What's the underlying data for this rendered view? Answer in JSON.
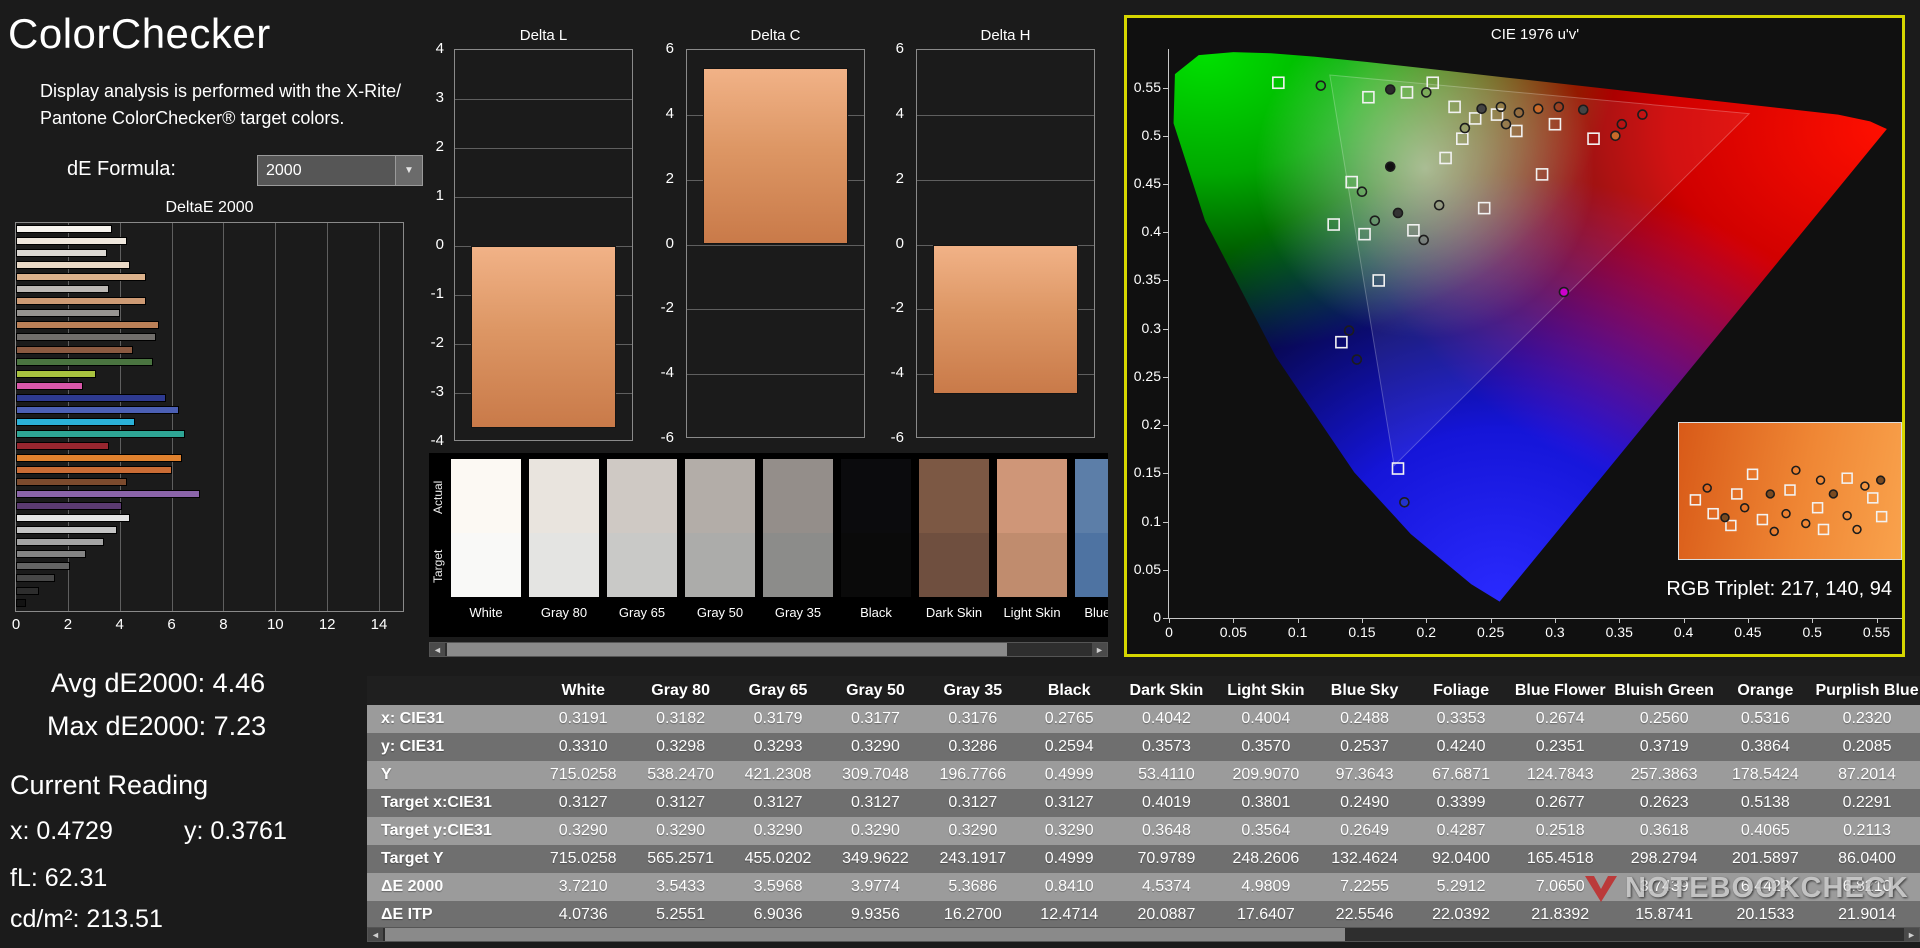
{
  "header": {
    "title": "ColorChecker",
    "description_line1": "Display analysis is performed with the X-Rite/",
    "description_line2": "Pantone ColorChecker® target colors.",
    "de_formula_label": "dE Formula:",
    "de_formula_value": "2000"
  },
  "readings": {
    "avg": "Avg dE2000: 4.46",
    "max": "Max dE2000: 7.23",
    "current_label": "Current Reading",
    "x": "x: 0.4729",
    "y": "y: 0.3761",
    "fl": "fL: 62.31",
    "cd": "cd/m²: 213.51"
  },
  "chart_data": [
    {
      "type": "bar",
      "title": "DeltaE 2000",
      "orientation": "horizontal",
      "xlim": [
        0,
        14
      ],
      "x_ticks": [
        "0",
        "2",
        "4",
        "6",
        "8",
        "10",
        "12",
        "14"
      ],
      "grid": true,
      "bars": [
        {
          "color": "#f7f4ef",
          "value": 3.7
        },
        {
          "color": "#efe7dd",
          "value": 4.3
        },
        {
          "color": "#dcd8d3",
          "value": 3.5
        },
        {
          "color": "#ead9c6",
          "value": 4.4
        },
        {
          "color": "#dcb28c",
          "value": 5.0
        },
        {
          "color": "#bcb8b4",
          "value": 3.6
        },
        {
          "color": "#cd9a74",
          "value": 5.0
        },
        {
          "color": "#969390",
          "value": 4.0
        },
        {
          "color": "#bb8057",
          "value": 5.5
        },
        {
          "color": "#716e6b",
          "value": 5.4
        },
        {
          "color": "#8b5a41",
          "value": 4.5
        },
        {
          "color": "#4a7440",
          "value": 5.3
        },
        {
          "color": "#a8c23f",
          "value": 3.1
        },
        {
          "color": "#d957a9",
          "value": 2.6
        },
        {
          "color": "#2e3a90",
          "value": 5.8
        },
        {
          "color": "#4c60b5",
          "value": 6.3
        },
        {
          "color": "#2bb1d8",
          "value": 4.6
        },
        {
          "color": "#2ea595",
          "value": 6.5
        },
        {
          "color": "#97262f",
          "value": 3.6
        },
        {
          "color": "#e0812e",
          "value": 6.4
        },
        {
          "color": "#ca6c35",
          "value": 6.0
        },
        {
          "color": "#7c4b2e",
          "value": 4.3
        },
        {
          "color": "#8a64a9",
          "value": 7.1
        },
        {
          "color": "#5b3a71",
          "value": 4.1
        },
        {
          "color": "#e4e4e4",
          "value": 4.4
        },
        {
          "color": "#c4c4c4",
          "value": 3.9
        },
        {
          "color": "#a4a4a4",
          "value": 3.4
        },
        {
          "color": "#848484",
          "value": 2.7
        },
        {
          "color": "#646464",
          "value": 2.1
        },
        {
          "color": "#474747",
          "value": 1.5
        },
        {
          "color": "#2d2d2d",
          "value": 0.9
        },
        {
          "color": "#121212",
          "value": 0.4
        }
      ]
    },
    {
      "type": "bar",
      "title": "Delta L",
      "ylim": [
        -4,
        4
      ],
      "y_ticks": [
        "4",
        "3",
        "2",
        "1",
        "0",
        "-1",
        "-2",
        "-3",
        "-4"
      ],
      "value": -3.72,
      "bar_colors": [
        "#f1b287",
        "#dd9765",
        "#c97a49"
      ]
    },
    {
      "type": "bar",
      "title": "Delta C",
      "ylim": [
        -6,
        6
      ],
      "y_ticks": [
        "6",
        "4",
        "2",
        "0",
        "-2",
        "-4",
        "-6"
      ],
      "value": 5.45,
      "bar_colors": [
        "#f1b287",
        "#dd9765",
        "#c97a49"
      ]
    },
    {
      "type": "bar",
      "title": "Delta H",
      "ylim": [
        -6,
        6
      ],
      "y_ticks": [
        "6",
        "4",
        "2",
        "0",
        "-2",
        "-4",
        "-6"
      ],
      "value": -4.62,
      "bar_colors": [
        "#f1b287",
        "#dd9765",
        "#c97a49"
      ]
    },
    {
      "type": "scatter",
      "title": "CIE 1976 u'v'",
      "border_color": "#d6d600",
      "xlim": [
        0,
        0.569
      ],
      "ylim": [
        0,
        0.59
      ],
      "x_ticks": [
        "0",
        "0.05",
        "0.1",
        "0.15",
        "0.2",
        "0.25",
        "0.3",
        "0.35",
        "0.4",
        "0.45",
        "0.5",
        "0.55"
      ],
      "y_ticks": [
        "0",
        "0.05",
        "0.1",
        "0.15",
        "0.2",
        "0.25",
        "0.3",
        "0.35",
        "0.4",
        "0.45",
        "0.5",
        "0.55"
      ],
      "rgb_triplet": "RGB Triplet: 217, 140, 94",
      "gamut_triangle": [
        [
          0.125,
          0.563
        ],
        [
          0.451,
          0.523
        ],
        [
          0.175,
          0.158
        ]
      ],
      "targets": [
        [
          0.085,
          0.555
        ],
        [
          0.155,
          0.54
        ],
        [
          0.185,
          0.545
        ],
        [
          0.205,
          0.555
        ],
        [
          0.222,
          0.53
        ],
        [
          0.238,
          0.518
        ],
        [
          0.255,
          0.522
        ],
        [
          0.27,
          0.505
        ],
        [
          0.3,
          0.512
        ],
        [
          0.33,
          0.497
        ],
        [
          0.228,
          0.497
        ],
        [
          0.215,
          0.477
        ],
        [
          0.142,
          0.452
        ],
        [
          0.128,
          0.408
        ],
        [
          0.152,
          0.398
        ],
        [
          0.19,
          0.402
        ],
        [
          0.163,
          0.35
        ],
        [
          0.134,
          0.286
        ],
        [
          0.178,
          0.155
        ],
        [
          0.245,
          0.425
        ],
        [
          0.29,
          0.46
        ]
      ],
      "measured": [
        [
          0.118,
          0.552,
          "none"
        ],
        [
          0.172,
          0.548,
          "#2a2a2a"
        ],
        [
          0.2,
          0.545,
          "none"
        ],
        [
          0.243,
          0.528,
          "#444444"
        ],
        [
          0.258,
          0.53,
          "none"
        ],
        [
          0.272,
          0.524,
          "none"
        ],
        [
          0.287,
          0.528,
          "#c96a2a"
        ],
        [
          0.303,
          0.53,
          "none"
        ],
        [
          0.322,
          0.527,
          "#444444"
        ],
        [
          0.352,
          0.512,
          "none"
        ],
        [
          0.172,
          0.468,
          "#111111"
        ],
        [
          0.15,
          0.442,
          "none"
        ],
        [
          0.16,
          0.412,
          "none"
        ],
        [
          0.178,
          0.42,
          "#333333"
        ],
        [
          0.198,
          0.392,
          "none"
        ],
        [
          0.14,
          0.298,
          "none"
        ],
        [
          0.146,
          0.268,
          "none"
        ],
        [
          0.307,
          0.338,
          "#cc00cc"
        ],
        [
          0.21,
          0.428,
          "none"
        ],
        [
          0.183,
          0.12,
          "#2233cc"
        ],
        [
          0.347,
          0.5,
          "#c96a2a"
        ],
        [
          0.368,
          0.522,
          "none"
        ],
        [
          0.262,
          0.512,
          "none"
        ],
        [
          0.23,
          0.508,
          "none"
        ]
      ],
      "inset": {
        "gradient": [
          "#d85a18",
          "#ef8634",
          "#f9a24c"
        ],
        "squares": [
          [
            16,
            78
          ],
          [
            34,
            92
          ],
          [
            58,
            72
          ],
          [
            84,
            98
          ],
          [
            112,
            68
          ],
          [
            140,
            86
          ],
          [
            170,
            56
          ],
          [
            196,
            76
          ],
          [
            146,
            108
          ],
          [
            74,
            52
          ],
          [
            205,
            95
          ],
          [
            52,
            104
          ]
        ],
        "circles": [
          [
            28,
            66,
            "none"
          ],
          [
            46,
            96,
            "#7a4a20"
          ],
          [
            66,
            86,
            "none"
          ],
          [
            92,
            72,
            "#7a4a20"
          ],
          [
            108,
            92,
            "none"
          ],
          [
            128,
            102,
            "none"
          ],
          [
            156,
            72,
            "#7a4a20"
          ],
          [
            170,
            94,
            "none"
          ],
          [
            188,
            64,
            "none"
          ],
          [
            204,
            58,
            "#7a4a20"
          ],
          [
            118,
            48,
            "none"
          ],
          [
            143,
            58,
            "none"
          ],
          [
            96,
            110,
            "none"
          ],
          [
            180,
            108,
            "none"
          ]
        ]
      }
    }
  ],
  "swatches": {
    "row_labels": [
      "Actual",
      "Target"
    ],
    "items": [
      {
        "name": "White",
        "actual": "#fcf9f3",
        "target": "#f9f9f7"
      },
      {
        "name": "Gray 80",
        "actual": "#e9e4de",
        "target": "#e4e4e2"
      },
      {
        "name": "Gray 65",
        "actual": "#cfc9c4",
        "target": "#c9c9c7"
      },
      {
        "name": "Gray 50",
        "actual": "#b3ada8",
        "target": "#acacaa"
      },
      {
        "name": "Gray 35",
        "actual": "#948e8a",
        "target": "#8c8c8a"
      },
      {
        "name": "Black",
        "actual": "#0b0b0d",
        "target": "#0a0a0a"
      },
      {
        "name": "Dark Skin",
        "actual": "#7c5844",
        "target": "#6f4f3f"
      },
      {
        "name": "Light Skin",
        "actual": "#cf9678",
        "target": "#c08c6e"
      },
      {
        "name": "Blue Sky",
        "actual": "#5c7ea8",
        "target": "#4e73a2"
      }
    ]
  },
  "table": {
    "headers": [
      "",
      "White",
      "Gray 80",
      "Gray 65",
      "Gray 50",
      "Gray 35",
      "Black",
      "Dark Skin",
      "Light Skin",
      "Blue Sky",
      "Foliage",
      "Blue Flower",
      "Bluish Green",
      "Orange",
      "Purplish Blue"
    ],
    "rows": [
      {
        "label": "x: CIE31",
        "values": [
          "0.3191",
          "0.3182",
          "0.3179",
          "0.3177",
          "0.3176",
          "0.2765",
          "0.4042",
          "0.4004",
          "0.2488",
          "0.3353",
          "0.2674",
          "0.2560",
          "0.5316",
          "0.2320"
        ]
      },
      {
        "label": "y: CIE31",
        "values": [
          "0.3310",
          "0.3298",
          "0.3293",
          "0.3290",
          "0.3286",
          "0.2594",
          "0.3573",
          "0.3570",
          "0.2537",
          "0.4240",
          "0.2351",
          "0.3719",
          "0.3864",
          "0.2085"
        ]
      },
      {
        "label": "Y",
        "values": [
          "715.0258",
          "538.2470",
          "421.2308",
          "309.7048",
          "196.7766",
          "0.4999",
          "53.4110",
          "209.9070",
          "97.3643",
          "67.6871",
          "124.7843",
          "257.3863",
          "178.5424",
          "87.2014"
        ]
      },
      {
        "label": "Target x:CIE31",
        "values": [
          "0.3127",
          "0.3127",
          "0.3127",
          "0.3127",
          "0.3127",
          "0.3127",
          "0.4019",
          "0.3801",
          "0.2490",
          "0.3399",
          "0.2677",
          "0.2623",
          "0.5138",
          "0.2291"
        ]
      },
      {
        "label": "Target y:CIE31",
        "values": [
          "0.3290",
          "0.3290",
          "0.3290",
          "0.3290",
          "0.3290",
          "0.3290",
          "0.3648",
          "0.3564",
          "0.2649",
          "0.4287",
          "0.2518",
          "0.3618",
          "0.4065",
          "0.2113"
        ]
      },
      {
        "label": "Target Y",
        "values": [
          "715.0258",
          "565.2571",
          "455.0202",
          "349.9622",
          "243.1917",
          "0.4999",
          "70.9789",
          "248.2606",
          "132.4624",
          "92.0400",
          "165.4518",
          "298.2794",
          "201.5897",
          "86.0400"
        ]
      },
      {
        "label": "ΔE 2000",
        "values": [
          "3.7210",
          "3.5433",
          "3.5968",
          "3.9774",
          "5.3686",
          "0.8410",
          "4.5374",
          "4.9809",
          "7.2255",
          "5.2912",
          "7.0650",
          "3.7439",
          "6.4423",
          "6.8210"
        ]
      },
      {
        "label": "ΔE ITP",
        "values": [
          "4.0736",
          "5.2551",
          "6.9036",
          "9.9356",
          "16.2700",
          "12.4714",
          "20.0887",
          "17.6407",
          "22.5546",
          "22.0392",
          "21.8392",
          "15.8741",
          "20.1533",
          "21.9014"
        ]
      }
    ]
  },
  "watermark": {
    "text": "NOTEBOOKCHECK",
    "logo_color": "#c42222"
  }
}
